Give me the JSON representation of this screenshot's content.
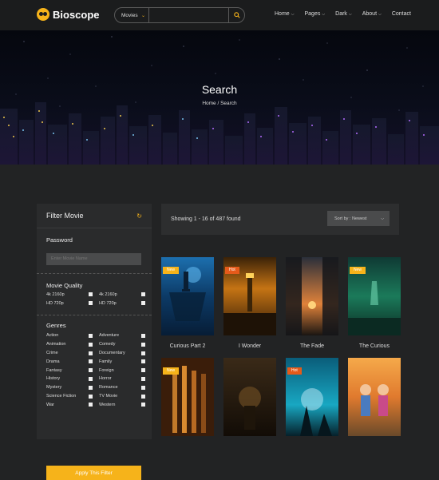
{
  "header": {
    "logo_text": "Bioscope",
    "search": {
      "category": "Movies",
      "placeholder": ""
    },
    "nav": [
      "Home",
      "Pages",
      "Dark",
      "About",
      "Contact"
    ]
  },
  "hero": {
    "title": "Search",
    "breadcrumb": "Home  /  Search"
  },
  "filter": {
    "title": "Filter Movie",
    "password_label": "Password",
    "password_placeholder": "Enter Movie Name",
    "quality_label": "Movie Quality",
    "quality": [
      "4k 2160p",
      "4k 2160p",
      "HD 720p",
      "HD 720p"
    ],
    "genres_label": "Genres",
    "genres": [
      "Action",
      "Adventure",
      "Animation",
      "Comedy",
      "Crime",
      "Documentary",
      "Drama",
      "Family",
      "Fantasy",
      "Foreign",
      "History",
      "Horror",
      "Mystery",
      "Romance",
      "Science Fiction",
      "TV Movie",
      "War",
      "Western"
    ],
    "apply_label": "Apply This Filter"
  },
  "toolbar": {
    "showing": "Showing 1 - 16 of 487 found",
    "sort": "Sort by : Newest"
  },
  "movies": [
    {
      "title": "Curious Part 2",
      "badge": "New"
    },
    {
      "title": "I Wonder",
      "badge": "Hot"
    },
    {
      "title": "The Fade",
      "badge": ""
    },
    {
      "title": "The Curious",
      "badge": "New"
    },
    {
      "title": "",
      "badge": "New"
    },
    {
      "title": "",
      "badge": ""
    },
    {
      "title": "",
      "badge": "Hot"
    },
    {
      "title": "",
      "badge": ""
    }
  ]
}
